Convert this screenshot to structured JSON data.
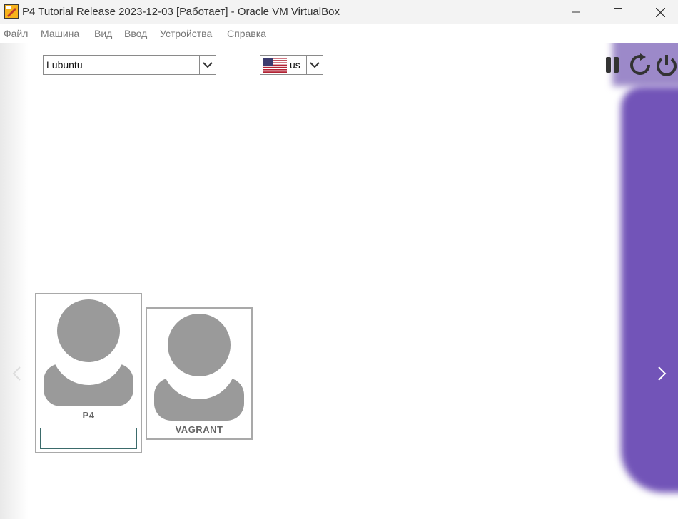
{
  "window": {
    "title": "P4 Tutorial Release 2023-12-03 [Работает] - Oracle VM VirtualBox"
  },
  "menu": {
    "items": [
      "Файл",
      "Машина",
      "Вид",
      "Ввод",
      "Устройства",
      "Справка"
    ]
  },
  "login": {
    "session": {
      "value": "Lubuntu"
    },
    "keyboard": {
      "value": "us",
      "flag_icon": "us-flag-icon"
    },
    "users": [
      {
        "name": "P4",
        "selected": true
      },
      {
        "name": "VAGRANT",
        "selected": false
      }
    ],
    "password": {
      "value": ""
    }
  },
  "colors": {
    "accent_purple": "#7254b8",
    "avatar_gray": "#9a9a9a",
    "border_gray": "#a9a9a9"
  }
}
